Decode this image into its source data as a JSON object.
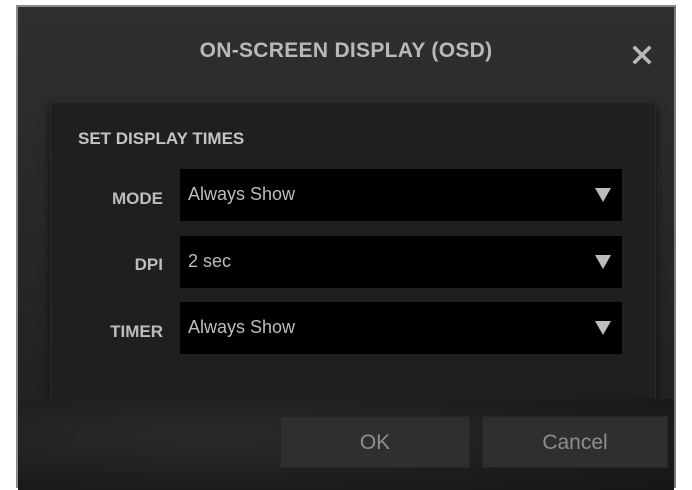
{
  "dialog": {
    "title": "ON-SCREEN DISPLAY (OSD)",
    "close_icon": "close-icon"
  },
  "section": {
    "title": "SET DISPLAY TIMES",
    "rows": [
      {
        "label": "MODE",
        "value": "Always Show",
        "icon": "dropdown-arrow-icon"
      },
      {
        "label": "DPI",
        "value": "2 sec",
        "icon": "dropdown-arrow-icon"
      },
      {
        "label": "TIMER",
        "value": "Always Show",
        "icon": "dropdown-arrow-icon"
      }
    ]
  },
  "buttons": {
    "ok_label": "OK",
    "cancel_label": "Cancel"
  },
  "colors": {
    "background": "#262626",
    "text": "#bdbdbd",
    "select_bg": "#000000",
    "button_bg": "#2f2f2f",
    "button_text": "#8e8e8e"
  }
}
